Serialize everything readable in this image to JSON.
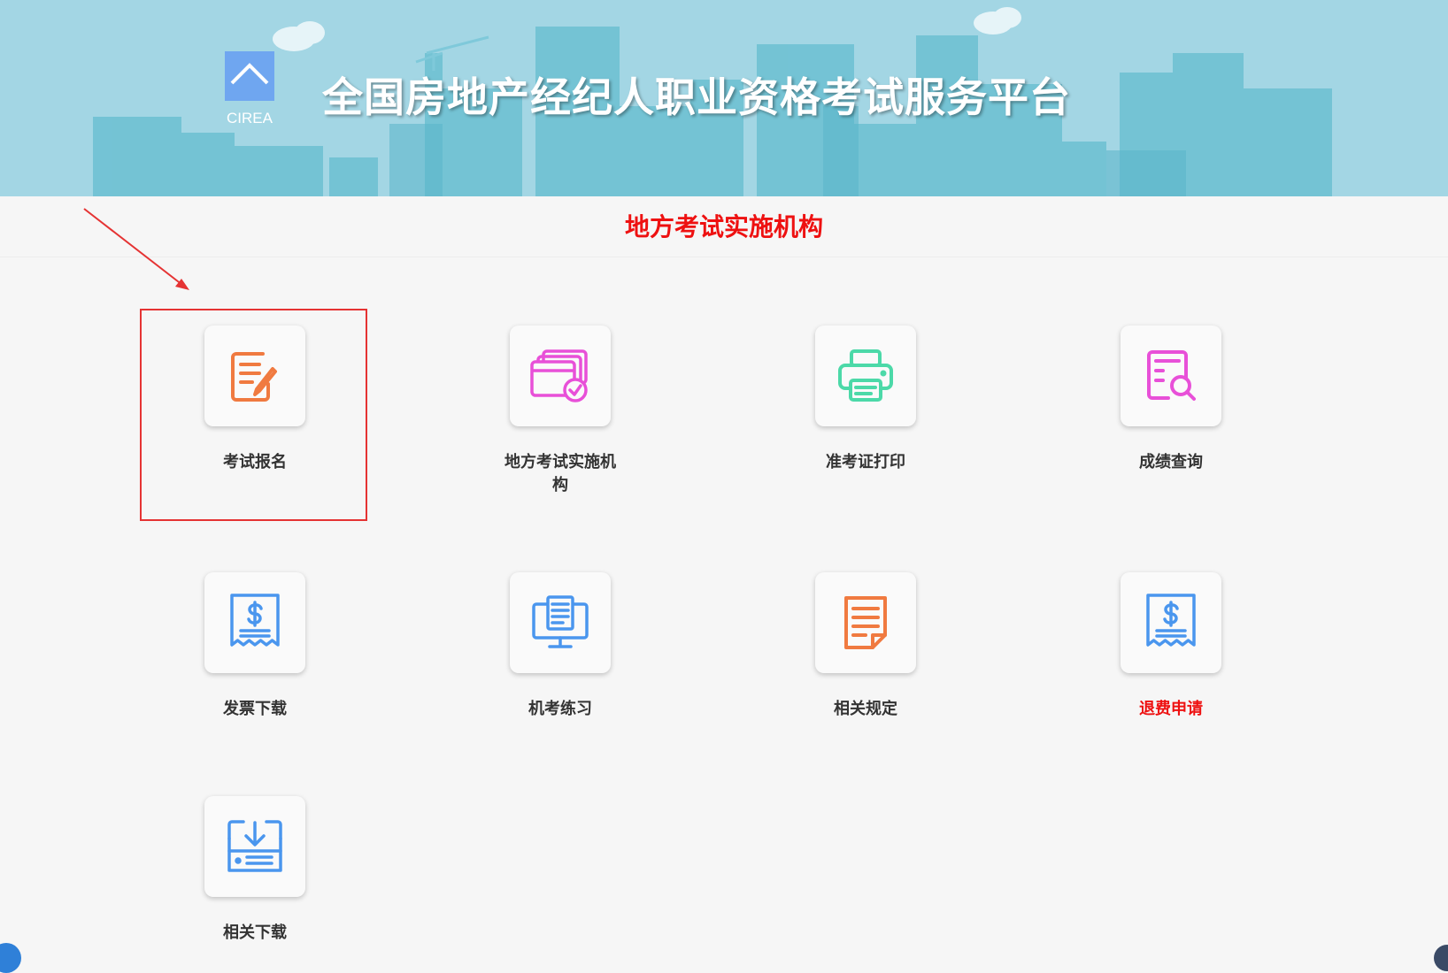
{
  "header": {
    "logo_text": "CIREA",
    "site_title": "全国房地产经纪人职业资格考试服务平台"
  },
  "subheader": {
    "title": "地方考试实施机构"
  },
  "colors": {
    "banner_bg": "#a3d6e4",
    "highlight": "#e53333",
    "accent_red": "#ee1111"
  },
  "tiles": [
    {
      "label": "考试报名",
      "icon": "registration-form-icon"
    },
    {
      "label": "地方考试实施机构",
      "icon": "institution-cards-icon"
    },
    {
      "label": "准考证打印",
      "icon": "printer-icon"
    },
    {
      "label": "成绩查询",
      "icon": "score-search-icon"
    },
    {
      "label": "发票下载",
      "icon": "invoice-receipt-icon"
    },
    {
      "label": "机考练习",
      "icon": "computer-practice-icon"
    },
    {
      "label": "相关规定",
      "icon": "regulations-document-icon"
    },
    {
      "label": "退费申请",
      "icon": "refund-receipt-icon"
    },
    {
      "label": "相关下载",
      "icon": "download-icon"
    }
  ]
}
